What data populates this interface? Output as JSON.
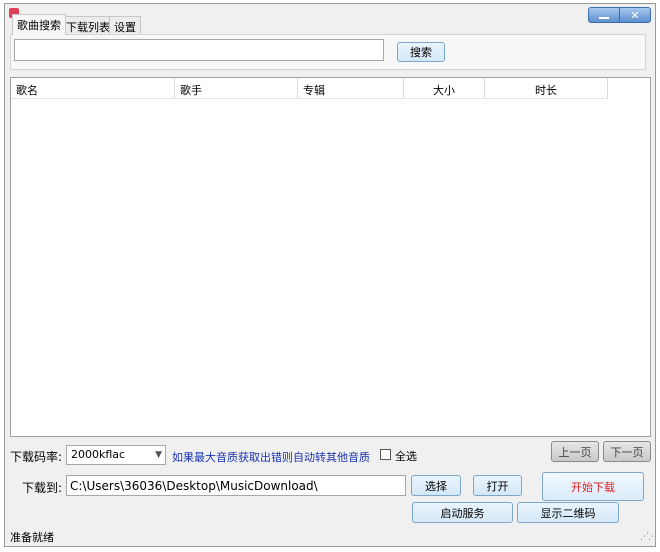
{
  "titlebar": {
    "minimize_glyph": "—",
    "close_glyph": "✕"
  },
  "tabs": [
    {
      "label": "歌曲搜索",
      "active": true
    },
    {
      "label": "下载列表",
      "active": false
    },
    {
      "label": "设置",
      "active": false
    }
  ],
  "search": {
    "value": "",
    "placeholder": "",
    "button_label": "搜索"
  },
  "results": {
    "columns": [
      "歌名",
      "歌手",
      "专辑",
      "大小",
      "时长"
    ],
    "rows": []
  },
  "options": {
    "bitrate_label": "下载码率:",
    "bitrate_value": "2000kflac",
    "hint": "如果最大音质获取出错则自动转其他音质",
    "select_all_label": "全选",
    "select_all_checked": false
  },
  "pager": {
    "prev_label": "上一页",
    "next_label": "下一页"
  },
  "download": {
    "to_label": "下载到:",
    "path": "C:\\Users\\36036\\Desktop\\MusicDownload\\",
    "choose_label": "选择",
    "open_label": "打开",
    "start_label": "开始下载",
    "start_service_label": "启动服务",
    "show_qr_label": "显示二维码"
  },
  "status": {
    "text": "准备就绪"
  },
  "icons": {
    "app": "app-icon",
    "dropdown": "chevron-down-icon",
    "resize": "resize-grip-icon"
  },
  "colors": {
    "hint": "#1a33b3",
    "start_download_text": "#e02020",
    "title_buttons": "#5d8fd0"
  }
}
